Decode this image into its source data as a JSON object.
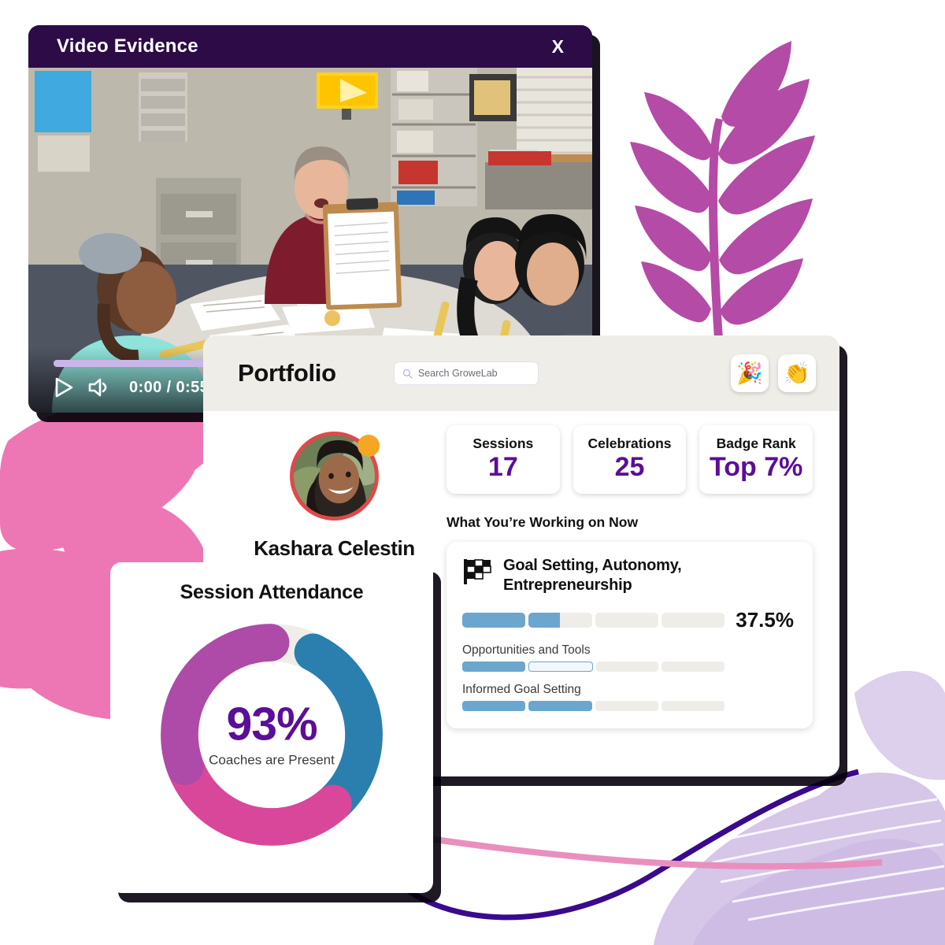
{
  "video_modal": {
    "title": "Video Evidence",
    "close_label": "X",
    "time_label": "0:00 / 0:55",
    "progress_percent": 47,
    "play_icon": "play-icon",
    "volume_icon": "volume-icon",
    "thumbnail_alt": "Classroom with teacher and students at a table"
  },
  "portfolio": {
    "title": "Portfolio",
    "search": {
      "placeholder": "Search GroweLab",
      "value": "",
      "icon": "search-icon"
    },
    "actions": [
      {
        "name": "celebrate-button",
        "glyph": "🎉",
        "icon": "party-popper-icon"
      },
      {
        "name": "applaud-button",
        "glyph": "👏",
        "icon": "clapping-hands-icon"
      }
    ],
    "profile": {
      "name": "Kashara Celestin",
      "badge_color": "#F5A623",
      "ring_color": "#E0484A"
    },
    "stats": [
      {
        "label": "Sessions",
        "value": "17"
      },
      {
        "label": "Celebrations",
        "value": "25"
      },
      {
        "label": "Badge Rank",
        "value": "Top 7%"
      }
    ],
    "working_on_now": {
      "heading": "What You’re Working on Now",
      "goal_icon": "checkered-flag-icon",
      "goal_name": "Goal Setting, Autonomy, Entrepreneurship",
      "percent_label": "37.5%",
      "main_segments": [
        "full",
        "half",
        "empty",
        "empty"
      ],
      "subgoals": [
        {
          "label": "Opportunities and Tools",
          "segments": [
            "full",
            "outline",
            "empty",
            "empty"
          ]
        },
        {
          "label": "Informed Goal Setting",
          "segments": [
            "full",
            "full",
            "empty",
            "empty"
          ]
        }
      ]
    }
  },
  "attendance": {
    "title": "Session Attendance",
    "center_value": "93%",
    "center_caption": "Coaches are Present"
  },
  "colors": {
    "purple_dark": "#2D0B47",
    "accent_purple": "#5B0E96",
    "donut_blue": "#2B7FAE",
    "donut_pink": "#D9479A",
    "donut_purple": "#AE4BA8",
    "donut_empty": "#EFEDE8",
    "progress_blue": "#6BA6CE",
    "header_bg": "#EFEDE8",
    "deco_pink": "#ED77B4",
    "deco_magenta": "#B44BA6",
    "deco_lavender": "#D6C6E8"
  },
  "chart_data": {
    "type": "pie",
    "title": "Session Attendance",
    "center_label": "93%",
    "center_sublabel": "Coaches are Present",
    "categories": [
      "Blue segment",
      "Pink segment",
      "Purple segment",
      "Absent (empty)"
    ],
    "values": [
      31,
      31,
      31,
      7
    ],
    "colors": [
      "#2B7FAE",
      "#D9479A",
      "#AE4BA8",
      "#EFEDE8"
    ],
    "units": "percent",
    "donut": true,
    "legend": "none"
  }
}
